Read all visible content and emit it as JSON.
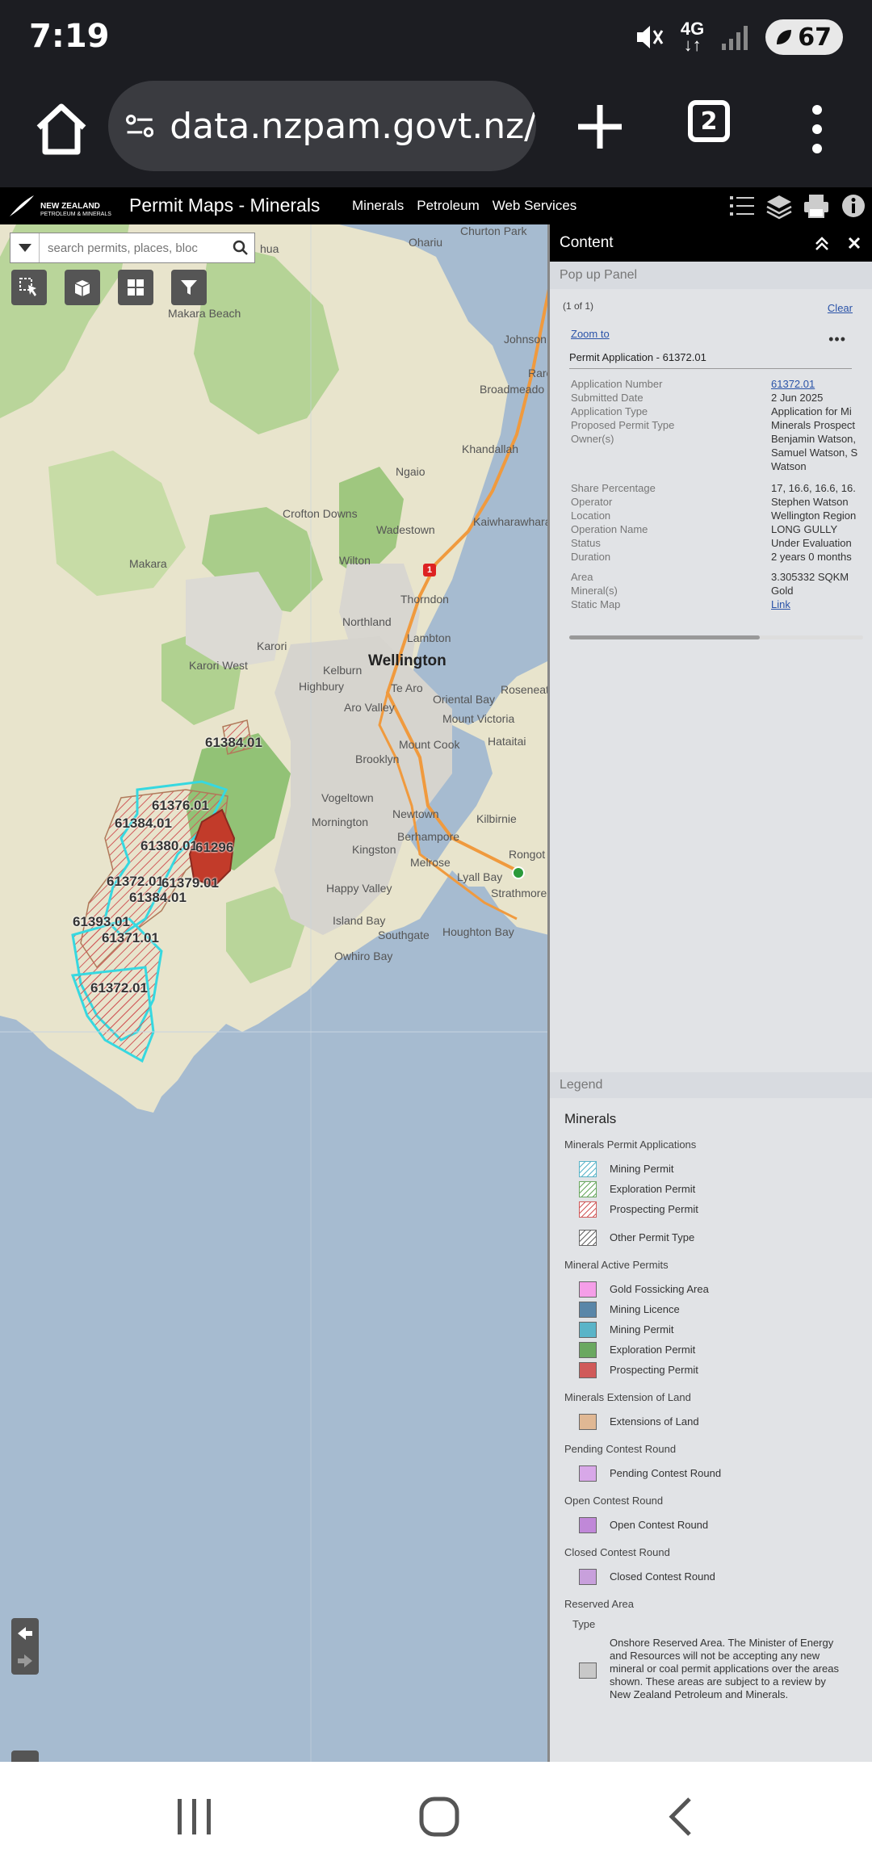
{
  "status_bar": {
    "time": "7:19",
    "network": "4G",
    "battery": "67"
  },
  "browser": {
    "url": "data.nzpam.govt.nz/",
    "tab_count": "2"
  },
  "app_header": {
    "logo_line1": "NEW ZEALAND",
    "logo_line2": "PETROLEUM & MINERALS",
    "title": "Permit Maps - Minerals",
    "nav": [
      "Minerals",
      "Petroleum",
      "Web Services"
    ]
  },
  "search": {
    "placeholder": "search permits, places, bloc"
  },
  "map": {
    "places": [
      {
        "id": "churton-park",
        "text": "Churton Park"
      },
      {
        "id": "ohariu",
        "text": "Ohariu"
      },
      {
        "id": "makara-beach",
        "text": "Makara Beach"
      },
      {
        "id": "johnsonville",
        "text": "Johnson"
      },
      {
        "id": "broadmeadows",
        "text": "Broadmeado"
      },
      {
        "id": "khandallah",
        "text": "Khandallah"
      },
      {
        "id": "ngaio",
        "text": "Ngaio"
      },
      {
        "id": "crofton-downs",
        "text": "Crofton Downs"
      },
      {
        "id": "wadestown",
        "text": "Wadestown"
      },
      {
        "id": "kaiwharawhara",
        "text": "Kaiwharawhara"
      },
      {
        "id": "makara",
        "text": "Makara"
      },
      {
        "id": "wilton",
        "text": "Wilton"
      },
      {
        "id": "thorndon",
        "text": "Thorndon"
      },
      {
        "id": "northland",
        "text": "Northland"
      },
      {
        "id": "lambton",
        "text": "Lambton"
      },
      {
        "id": "karori",
        "text": "Karori"
      },
      {
        "id": "karori-west",
        "text": "Karori West"
      },
      {
        "id": "kelburn",
        "text": "Kelburn"
      },
      {
        "id": "wellington",
        "text": "Wellington"
      },
      {
        "id": "highbury",
        "text": "Highbury"
      },
      {
        "id": "te-aro",
        "text": "Te Aro"
      },
      {
        "id": "oriental-bay",
        "text": "Oriental Bay"
      },
      {
        "id": "roseneath",
        "text": "Roseneat"
      },
      {
        "id": "aro-valley",
        "text": "Aro Valley"
      },
      {
        "id": "mount-victoria",
        "text": "Mount Victoria"
      },
      {
        "id": "mount-cook",
        "text": "Mount Cook"
      },
      {
        "id": "hataitai",
        "text": "Hataitai"
      },
      {
        "id": "brooklyn",
        "text": "Brooklyn"
      },
      {
        "id": "vogeltown",
        "text": "Vogeltown"
      },
      {
        "id": "newtown",
        "text": "Newtown"
      },
      {
        "id": "mornington",
        "text": "Mornington"
      },
      {
        "id": "kilbirnie",
        "text": "Kilbirnie"
      },
      {
        "id": "berhampore",
        "text": "Berhampore"
      },
      {
        "id": "kingston",
        "text": "Kingston"
      },
      {
        "id": "melrose",
        "text": "Melrose"
      },
      {
        "id": "rongotai",
        "text": "Rongot"
      },
      {
        "id": "lyall-bay",
        "text": "Lyall Bay"
      },
      {
        "id": "happy-valley",
        "text": "Happy Valley"
      },
      {
        "id": "strathmore",
        "text": "Strathmore"
      },
      {
        "id": "island-bay",
        "text": "Island Bay"
      },
      {
        "id": "southgate",
        "text": "Southgate"
      },
      {
        "id": "houghton-bay",
        "text": "Houghton Bay"
      },
      {
        "id": "owhiro-bay",
        "text": "Owhiro Bay"
      },
      {
        "id": "hua",
        "text": "hua"
      },
      {
        "id": "raro",
        "text": "Raro"
      }
    ],
    "permits": [
      {
        "id": "61384-a",
        "text": "61384.01"
      },
      {
        "id": "61376",
        "text": "61376.01"
      },
      {
        "id": "61384-b",
        "text": "61384.01"
      },
      {
        "id": "61380",
        "text": "61380.01"
      },
      {
        "id": "61296",
        "text": "61296"
      },
      {
        "id": "61372-a",
        "text": "61372.01"
      },
      {
        "id": "61379",
        "text": "61379.01"
      },
      {
        "id": "61384-c",
        "text": "61384.01"
      },
      {
        "id": "61393",
        "text": "61393.01"
      },
      {
        "id": "61371",
        "text": "61371.01"
      },
      {
        "id": "61372-b",
        "text": "61372.01"
      }
    ],
    "highway_marker": "1"
  },
  "panel": {
    "title": "Content",
    "popup_section": "Pop up Panel",
    "count": "(1 of 1)",
    "clear": "Clear",
    "zoom_to": "Zoom to",
    "more": "•••",
    "feature_title": "Permit Application - 61372.01",
    "attributes": [
      {
        "key": "Application Number",
        "value": "61372.01",
        "link": true
      },
      {
        "key": "Submitted Date",
        "value": "2 Jun 2025"
      },
      {
        "key": "Application Type",
        "value": "Application for Mi"
      },
      {
        "key": "Proposed Permit Type",
        "value": "Minerals Prospect"
      },
      {
        "key": "Owner(s)",
        "value": "Benjamin Watson, Samuel Watson, S Watson",
        "multi": true
      },
      {
        "key": "Share Percentage",
        "value": "17, 16.6, 16.6, 16."
      },
      {
        "key": "Operator",
        "value": "Stephen Watson"
      },
      {
        "key": "Location",
        "value": "Wellington Region"
      },
      {
        "key": "Operation Name",
        "value": "LONG GULLY"
      },
      {
        "key": "Status",
        "value": "Under Evaluation"
      },
      {
        "key": "Duration",
        "value": "2 years 0 months"
      },
      {
        "key": "",
        "value": ""
      },
      {
        "key": "Area",
        "value": "3.305332 SQKM"
      },
      {
        "key": "Mineral(s)",
        "value": "Gold"
      },
      {
        "key": "Static Map",
        "value": "Link",
        "link": true
      }
    ]
  },
  "legend": {
    "section": "Legend",
    "title": "Minerals",
    "groups": [
      {
        "name": "Minerals Permit Applications",
        "items": [
          {
            "label": "Mining Permit",
            "color": "#5ab4c8",
            "hatch": true
          },
          {
            "label": "Exploration Permit",
            "color": "#6aa860",
            "hatch": true
          },
          {
            "label": "Prospecting Permit",
            "color": "#d05a5a",
            "hatch": true
          },
          {
            "label": "Other Permit Type",
            "color": "#666666",
            "hatch": true
          }
        ]
      },
      {
        "name": "Mineral Active Permits",
        "items": [
          {
            "label": "Gold Fossicking Area",
            "color": "#f59ee8"
          },
          {
            "label": "Mining Licence",
            "color": "#5a86a8"
          },
          {
            "label": "Mining Permit",
            "color": "#5ab4c8"
          },
          {
            "label": "Exploration Permit",
            "color": "#6aa860"
          },
          {
            "label": "Prospecting Permit",
            "color": "#d05a5a"
          }
        ]
      },
      {
        "name": "Minerals Extension of Land",
        "items": [
          {
            "label": "Extensions of Land",
            "color": "#e0b894"
          }
        ]
      },
      {
        "name": "Pending Contest Round",
        "items": [
          {
            "label": "Pending Contest Round",
            "color": "#d8a8e8"
          }
        ]
      },
      {
        "name": "Open Contest Round",
        "items": [
          {
            "label": "Open Contest Round",
            "color": "#c088d8"
          }
        ]
      },
      {
        "name": "Closed Contest Round",
        "items": [
          {
            "label": "Closed Contest Round",
            "color": "#c8a0dc"
          }
        ]
      }
    ],
    "reserved_group": "Reserved Area",
    "reserved_type": "Type",
    "reserved_text": "Onshore Reserved Area. The Minister of Energy and Resources will not be accepting any new mineral or coal permit applications over the areas shown. These areas are subject to a review by New Zealand Petroleum and Minerals."
  }
}
